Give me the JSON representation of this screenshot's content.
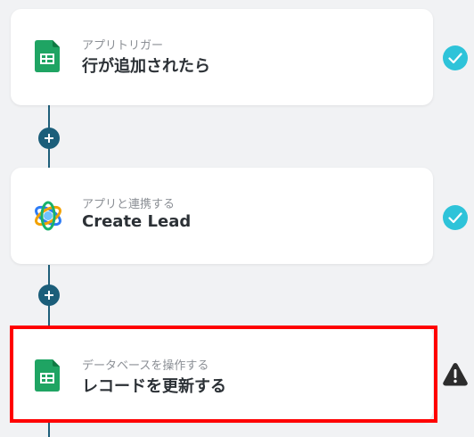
{
  "flow": {
    "steps": [
      {
        "subtitle": "アプリトリガー",
        "title": "行が追加されたら",
        "icon": "google-sheets-icon",
        "status": "check-icon"
      },
      {
        "subtitle": "アプリと連携する",
        "title": "Create Lead",
        "icon": "app-logo-icon",
        "status": "check-icon"
      },
      {
        "subtitle": "データベースを操作する",
        "title": "レコードを更新する",
        "icon": "google-sheets-icon",
        "status": "warning-icon"
      }
    ],
    "add_button_icon": "plus-icon"
  },
  "colors": {
    "background": "#f1f2f4",
    "connector": "#1f5f7a",
    "check": "#2ec3d9",
    "warning": "#2c2c2c",
    "sheets_green": "#1fa463",
    "highlight": "#ff0000"
  }
}
